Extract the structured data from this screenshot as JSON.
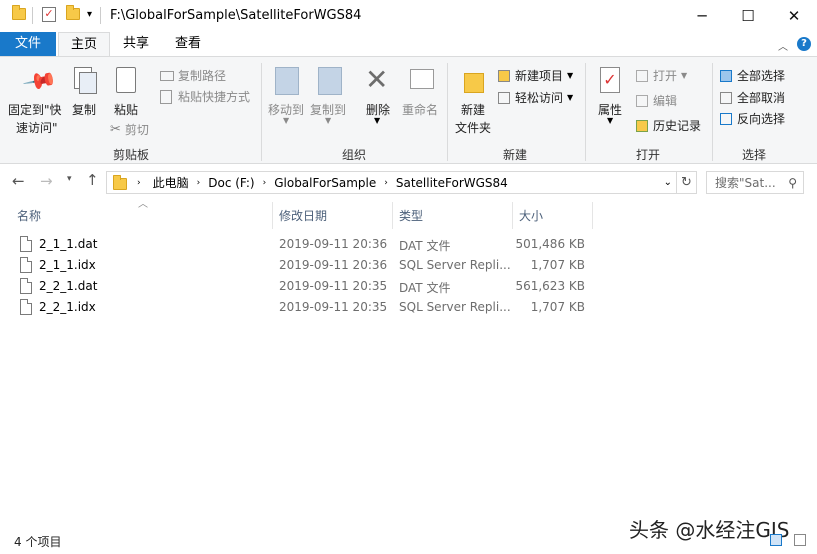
{
  "window": {
    "title": "F:\\GlobalForSample\\SatelliteForWGS84",
    "controls": {
      "minimize": "─",
      "maximize": "☐",
      "close": "✕"
    }
  },
  "ribbon_tabs": [
    "文件",
    "主页",
    "共享",
    "查看"
  ],
  "ribbon": {
    "clipboard": {
      "pin_line1": "固定到\"快",
      "pin_line2": "速访问\"",
      "copy": "复制",
      "paste": "粘贴",
      "copy_path": "复制路径",
      "paste_shortcut": "粘贴快捷方式",
      "cut": "剪切",
      "title": "剪贴板"
    },
    "organize": {
      "move_to": "移动到",
      "copy_to": "复制到",
      "delete": "删除",
      "rename": "重命名",
      "title": "组织"
    },
    "new": {
      "new_folder_line1": "新建",
      "new_folder_line2": "文件夹",
      "new_item": "新建项目",
      "easy_access": "轻松访问",
      "title": "新建"
    },
    "open": {
      "properties": "属性",
      "open": "打开",
      "edit": "编辑",
      "history": "历史记录",
      "title": "打开"
    },
    "select": {
      "select_all": "全部选择",
      "select_none": "全部取消",
      "invert": "反向选择",
      "title": "选择"
    }
  },
  "address": {
    "path": [
      "此电脑",
      "Doc (F:)",
      "GlobalForSample",
      "SatelliteForWGS84"
    ],
    "search_placeholder": "搜索\"Sat..."
  },
  "columns": {
    "name": "名称",
    "date": "修改日期",
    "type": "类型",
    "size": "大小"
  },
  "files": [
    {
      "name": "2_1_1.dat",
      "date": "2019-09-11 20:36",
      "type": "DAT 文件",
      "size": "501,486 KB"
    },
    {
      "name": "2_1_1.idx",
      "date": "2019-09-11 20:36",
      "type": "SQL Server Repli...",
      "size": "1,707 KB"
    },
    {
      "name": "2_2_1.dat",
      "date": "2019-09-11 20:35",
      "type": "DAT 文件",
      "size": "561,623 KB"
    },
    {
      "name": "2_2_1.idx",
      "date": "2019-09-11 20:35",
      "type": "SQL Server Repli...",
      "size": "1,707 KB"
    }
  ],
  "status": {
    "item_count": "4 个项目"
  },
  "watermark": "头条 @水经注GIS",
  "colors": {
    "accent": "#1979ca",
    "folder": "#f7c948",
    "ribbon_bg": "#f5f6f7"
  }
}
